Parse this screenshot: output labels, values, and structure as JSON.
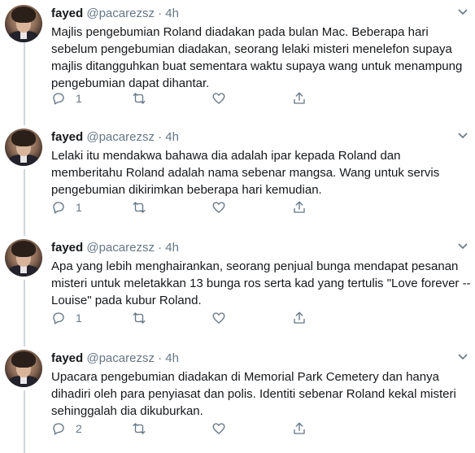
{
  "tweets": [
    {
      "name": "fayed",
      "handle": "@pacarezsz",
      "time": "· 4h",
      "text": "Majlis pengebumian Roland diadakan pada bulan Mac. Beberapa hari sebelum pengebumian diadakan, seorang lelaki misteri menelefon supaya majlis ditangguhkan buat sementara waktu supaya wang untuk menampung pengebumian dapat dihantar.",
      "replies": "1"
    },
    {
      "name": "fayed",
      "handle": "@pacarezsz",
      "time": "· 4h",
      "text": "Lelaki itu mendakwa bahawa dia adalah ipar kepada Roland dan memberitahu Roland adalah nama sebenar mangsa. Wang untuk servis pengebumian dikirimkan beberapa hari kemudian.",
      "replies": "1"
    },
    {
      "name": "fayed",
      "handle": "@pacarezsz",
      "time": "· 4h",
      "text": "Apa yang lebih menghairankan, seorang penjual bunga mendapat pesanan misteri untuk meletakkan 13 bunga ros serta kad yang tertulis \"Love forever -- Louise\" pada kubur Roland.",
      "replies": "1"
    },
    {
      "name": "fayed",
      "handle": "@pacarezsz",
      "time": "· 4h",
      "text": "Upacara pengebumian diadakan di Memorial Park Cemetery dan hanya dihadiri oleh para penyiasat dan polis. Identiti sebenar Roland kekal misteri sehinggalah dia dikuburkan.",
      "replies": "2"
    }
  ],
  "icons": [
    "reply-icon",
    "retweet-icon",
    "like-icon",
    "share-icon",
    "chevron-down-icon"
  ],
  "colors": {
    "text": "#14171a",
    "muted": "#657786",
    "thread_line": "#ccd6dd"
  }
}
